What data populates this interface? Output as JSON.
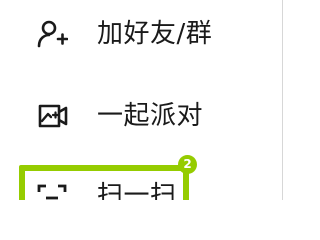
{
  "menu": {
    "items": [
      {
        "label": "加好友/群",
        "icon": "add-friend-icon"
      },
      {
        "label": "一起派对",
        "icon": "party-icon"
      },
      {
        "label": "扫一扫",
        "icon": "scan-icon"
      }
    ]
  },
  "highlight": {
    "badge": "2",
    "color": "#95cc00"
  }
}
